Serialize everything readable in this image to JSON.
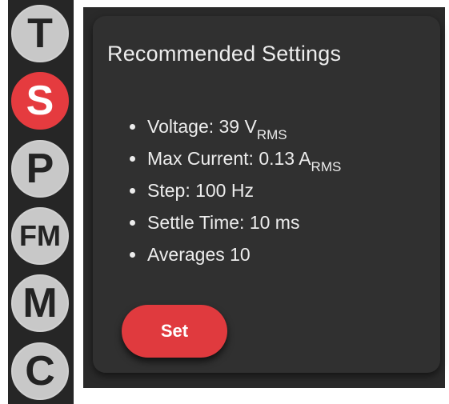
{
  "nav": {
    "items": [
      {
        "label": "T",
        "active": false
      },
      {
        "label": "S",
        "active": true
      },
      {
        "label": "P",
        "active": false
      },
      {
        "label": "FM",
        "active": false
      },
      {
        "label": "M",
        "active": false
      },
      {
        "label": "C",
        "active": false
      }
    ]
  },
  "panel": {
    "title": "Recommended Settings",
    "settings": [
      {
        "text": "Voltage: 39 V",
        "sub": "RMS"
      },
      {
        "text": "Max Current: 0.13 A",
        "sub": "RMS"
      },
      {
        "text": "Step: 100 Hz",
        "sub": ""
      },
      {
        "text": "Settle Time: 10 ms",
        "sub": ""
      },
      {
        "text": "Averages 10",
        "sub": ""
      }
    ],
    "button_label": "Set"
  },
  "colors": {
    "accent": "#e03a3e",
    "background": "#303030",
    "text": "#ececec"
  }
}
